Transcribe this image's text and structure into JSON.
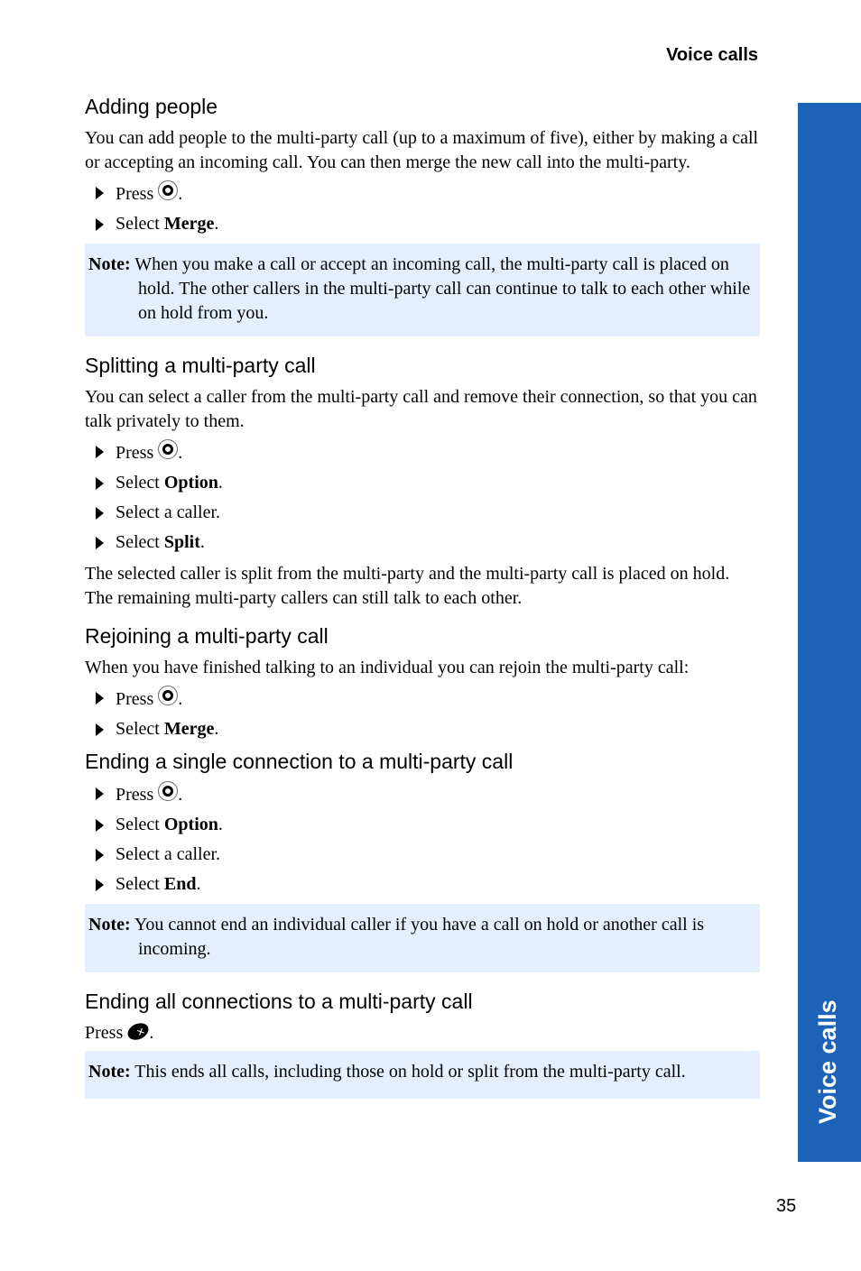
{
  "header": {
    "running_title": "Voice calls"
  },
  "side_tab": {
    "label": "Voice calls",
    "color": "#1c63b7"
  },
  "footer": {
    "page_number": "35"
  },
  "sections": [
    {
      "title": "Adding people",
      "intro": "You can add people to the multi-party call (up to a maximum of five), either by making a call or accepting an incoming call. You can then merge the new call into the multi-party.",
      "steps": [
        {
          "text": "Press",
          "icon": "navigation-key-icon",
          "suffix": "."
        },
        {
          "text": "Select",
          "bold": "Merge",
          "suffix": "."
        }
      ],
      "note": {
        "label": "Note:",
        "text": "When you make a call or accept an incoming call, the multi-party call is placed on hold. The other callers in the multi-party call can continue to talk to each other while on hold from you."
      }
    },
    {
      "title": "Splitting a multi-party call",
      "intro": "You can select a caller from the multi-party call and remove their connection, so that you can talk privately to them.",
      "steps": [
        {
          "text": "Press",
          "icon": "navigation-key-icon",
          "suffix": "."
        },
        {
          "text": "Select",
          "bold": "Option",
          "suffix": "."
        },
        {
          "text": "Select a caller."
        },
        {
          "text": "Select",
          "bold": "Split",
          "suffix": "."
        }
      ],
      "outro": "The selected caller is split from the multi-party and the multi-party call is placed on hold. The remaining multi-party callers can still talk to each other."
    },
    {
      "title": "Rejoining a multi-party call",
      "intro": "When you have finished talking to an individual you can rejoin the multi-party call:",
      "steps": [
        {
          "text": "Press",
          "icon": "navigation-key-icon",
          "suffix": "."
        },
        {
          "text": "Select",
          "bold": "Merge",
          "suffix": "."
        }
      ]
    },
    {
      "title": "Ending a single connection to a multi-party call",
      "steps": [
        {
          "text": "Press",
          "icon": "navigation-key-icon",
          "suffix": "."
        },
        {
          "text": "Select",
          "bold": "Option",
          "suffix": "."
        },
        {
          "text": "Select a caller."
        },
        {
          "text": "Select",
          "bold": "End",
          "suffix": "."
        }
      ],
      "note": {
        "label": "Note:",
        "text": "You cannot end an individual caller if you have a call on hold or another call is incoming."
      }
    },
    {
      "title": "Ending all connections to a multi-party call",
      "press_line": {
        "text": "Press",
        "icon": "end-call-key-icon",
        "suffix": "."
      },
      "note": {
        "label": "Note:",
        "text": "This ends all calls, including those on hold or split from the multi-party call."
      }
    }
  ]
}
